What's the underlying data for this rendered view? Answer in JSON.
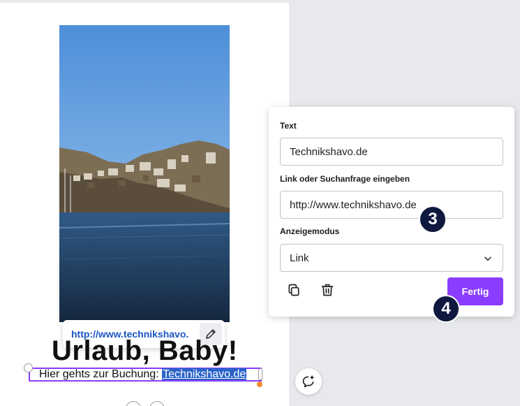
{
  "canvas": {
    "link_preview": "http://www.technikshavo.",
    "headline": "Urlaub, Baby!",
    "subline_prefix": "Hier gehts zur Buchung: ",
    "subline_link": "Technikshavo.de"
  },
  "link_panel": {
    "text_label": "Text",
    "text_value": "Technikshavo.de",
    "link_label": "Link oder Suchanfrage eingeben",
    "link_value": "http://www.technikshavo.de",
    "mode_label": "Anzeigemodus",
    "mode_value": "Link",
    "done_label": "Fertig"
  },
  "badges": {
    "step3": "3",
    "step4": "4"
  },
  "colors": {
    "accent": "#8b3dff",
    "badge": "#0f1940",
    "link": "#1a56c4",
    "selection_highlight": "#2962c9"
  },
  "icons": [
    "pencil-icon",
    "comment-add-icon",
    "copy-icon",
    "trash-icon",
    "chevron-down-icon"
  ]
}
